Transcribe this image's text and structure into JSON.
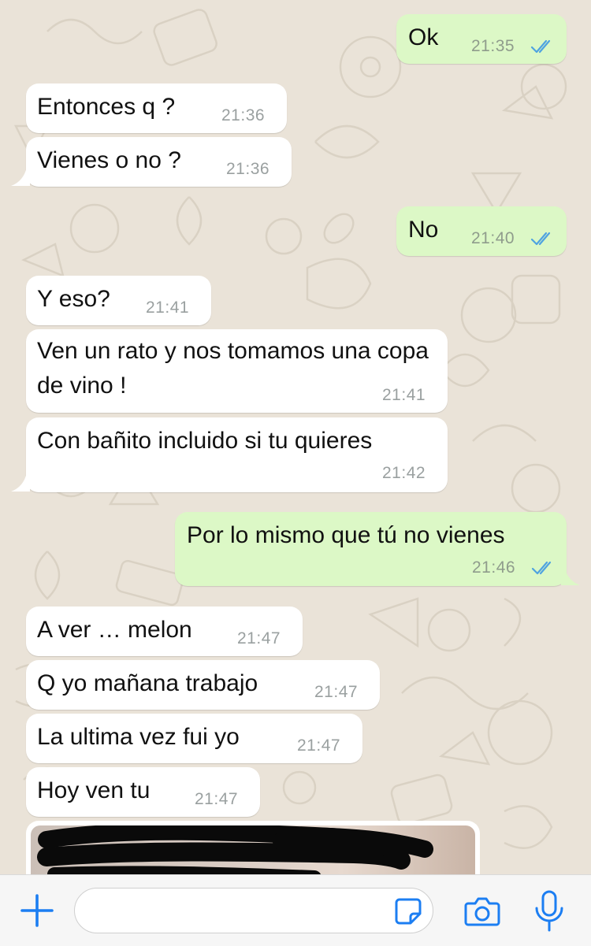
{
  "colors": {
    "incoming_bubble": "#FFFFFF",
    "outgoing_bubble": "#DCF8C6",
    "read_ticks": "#4FA3E0",
    "accent": "#1C7EF2"
  },
  "messages": [
    {
      "dir": "out",
      "text": "Ok",
      "time": "21:35",
      "status": "read"
    },
    {
      "dir": "in",
      "text": "Entonces q ?",
      "time": "21:36"
    },
    {
      "dir": "in",
      "text": "Vienes o no ?",
      "time": "21:36"
    },
    {
      "dir": "out",
      "text": "No",
      "time": "21:40",
      "status": "read"
    },
    {
      "dir": "in",
      "text": "Y eso?",
      "time": "21:41"
    },
    {
      "dir": "in",
      "text": "Ven un rato y nos tomamos una copa de vino !",
      "time": "21:41"
    },
    {
      "dir": "in",
      "text": "Con bañito incluido si tu quieres",
      "time": "21:42"
    },
    {
      "dir": "out",
      "text": "Por lo mismo que tú no vienes",
      "time": "21:46",
      "status": "read"
    },
    {
      "dir": "in",
      "text": "A ver … melon",
      "time": "21:47"
    },
    {
      "dir": "in",
      "text": "Q yo mañana trabajo",
      "time": "21:47"
    },
    {
      "dir": "in",
      "text": "La ultima vez fui yo",
      "time": "21:47"
    },
    {
      "dir": "in",
      "text": "Hoy ven tu",
      "time": "21:47"
    }
  ],
  "photo_message": {
    "type": "image",
    "redacted": true
  },
  "input_bar": {
    "placeholder": "",
    "value": "",
    "icons": [
      "plus-icon",
      "sticker-icon",
      "camera-icon",
      "microphone-icon"
    ]
  }
}
